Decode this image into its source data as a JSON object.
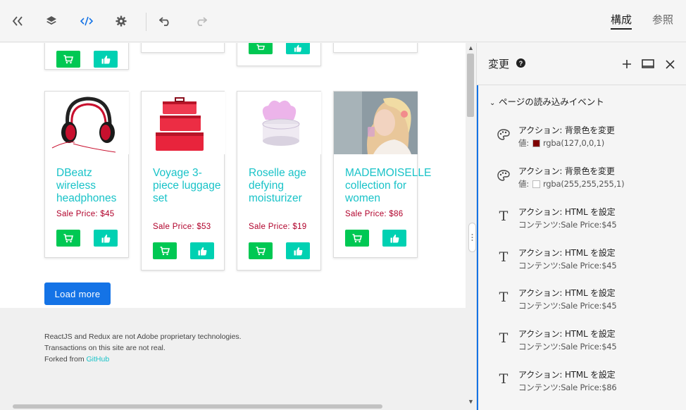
{
  "toolbar": {
    "tabs": [
      {
        "label": "構成",
        "active": true
      },
      {
        "label": "参照",
        "active": false
      }
    ]
  },
  "products": [
    {
      "name": "DBeatz wireless headphones",
      "price": "Sale Price: $45"
    },
    {
      "name": "Voyage 3-piece luggage set",
      "price": "Sale Price: $53"
    },
    {
      "name": "Roselle age defying moisturizer",
      "price": "Sale Price: $19"
    },
    {
      "name": "MADEMOISELLE collection for women",
      "price": "Sale Price: $86"
    }
  ],
  "load_more_label": "Load more",
  "footer": {
    "line1": "ReactJS and Redux are not Adobe proprietary technologies.",
    "line2": "Transactions on this site are not real.",
    "line3_prefix": "Forked from ",
    "line3_link": "GitHub"
  },
  "panel": {
    "title": "変更",
    "help": "?",
    "group_title": "ページの読み込みイベント",
    "actions": [
      {
        "icon": "palette-icon",
        "title": "アクション: 背景色を変更",
        "sub_label": "値:",
        "swatch_color": "#7f0000",
        "sub_value": "rgba(127,0,0,1)"
      },
      {
        "icon": "palette-icon",
        "title": "アクション: 背景色を変更",
        "sub_label": "値:",
        "swatch_color": "#ffffff",
        "sub_value": "rgba(255,255,255,1)"
      },
      {
        "icon": "text-icon",
        "title": "アクション: HTML を設定",
        "sub_label": "コンテンツ:",
        "sub_value": "Sale Price:$45"
      },
      {
        "icon": "text-icon",
        "title": "アクション: HTML を設定",
        "sub_label": "コンテンツ:",
        "sub_value": "Sale Price:$45"
      },
      {
        "icon": "text-icon",
        "title": "アクション: HTML を設定",
        "sub_label": "コンテンツ:",
        "sub_value": "Sale Price:$45"
      },
      {
        "icon": "text-icon",
        "title": "アクション: HTML を設定",
        "sub_label": "コンテンツ:",
        "sub_value": "Sale Price:$45"
      },
      {
        "icon": "text-icon",
        "title": "アクション: HTML を設定",
        "sub_label": "コンテンツ:",
        "sub_value": "Sale Price:$86"
      }
    ]
  },
  "colors": {
    "accent": "#1473e6",
    "name_teal": "#19c3c8",
    "price_red": "#b0002a",
    "cart_green": "#00c853",
    "like_teal": "#00d1b2"
  },
  "icons": [
    "collapse-panel-icon",
    "layers-icon",
    "code-icon",
    "gear-icon",
    "undo-icon",
    "redo-icon",
    "add-icon",
    "device-icon",
    "close-icon"
  ]
}
